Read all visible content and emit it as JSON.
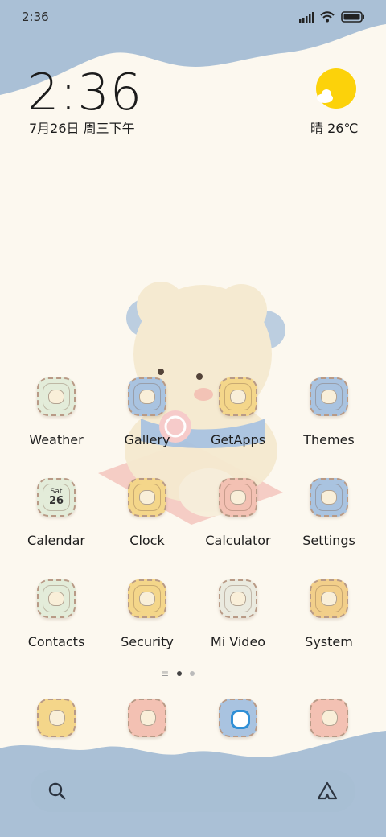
{
  "status_bar": {
    "time": "2:36"
  },
  "clock_widget": {
    "time": "2:36",
    "date": "7月26日 周三下午"
  },
  "weather_widget": {
    "text": "晴 26℃"
  },
  "apps": [
    {
      "label": "Weather",
      "icon": "umbrella-icon",
      "color": "#e3ecd9"
    },
    {
      "label": "Gallery",
      "icon": "bear-photo-icon",
      "color": "#a9c3e0"
    },
    {
      "label": "GetApps",
      "icon": "lipstick-icon",
      "color": "#f4d68a"
    },
    {
      "label": "Themes",
      "icon": "cat-face-icon",
      "color": "#a9c3e0"
    },
    {
      "label": "Calendar",
      "icon": "calendar-icon",
      "color": "#e3ecd9"
    },
    {
      "label": "Clock",
      "icon": "alarm-clock-icon",
      "color": "#f4d68a"
    },
    {
      "label": "Calculator",
      "icon": "calculator-icon",
      "color": "#f3c1b3"
    },
    {
      "label": "Settings",
      "icon": "flower-cat-icon",
      "color": "#a9c3e0"
    },
    {
      "label": "Contacts",
      "icon": "contact-book-icon",
      "color": "#e3ecd9"
    },
    {
      "label": "Security",
      "icon": "shield-bear-icon",
      "color": "#f4d68a"
    },
    {
      "label": "Mi Video",
      "icon": "video-ticket-icon",
      "color": "#eaeadf"
    },
    {
      "label": "System",
      "icon": "folder-icon",
      "color": "#f2cf8a"
    }
  ],
  "calendar_icon": {
    "day_name": "Sat",
    "day_number": "26"
  },
  "dock": [
    {
      "icon": "phone-bird-icon",
      "color": "#f4d68a"
    },
    {
      "icon": "message-bear-icon",
      "color": "#f3c1b3"
    },
    {
      "icon": "browser-ring-icon",
      "color": "#a9c3e0"
    },
    {
      "icon": "camera-icon",
      "color": "#f3c1b3"
    }
  ],
  "search_bar": {
    "search_icon": "search-icon",
    "assistant_icon": "assistant-icon"
  }
}
